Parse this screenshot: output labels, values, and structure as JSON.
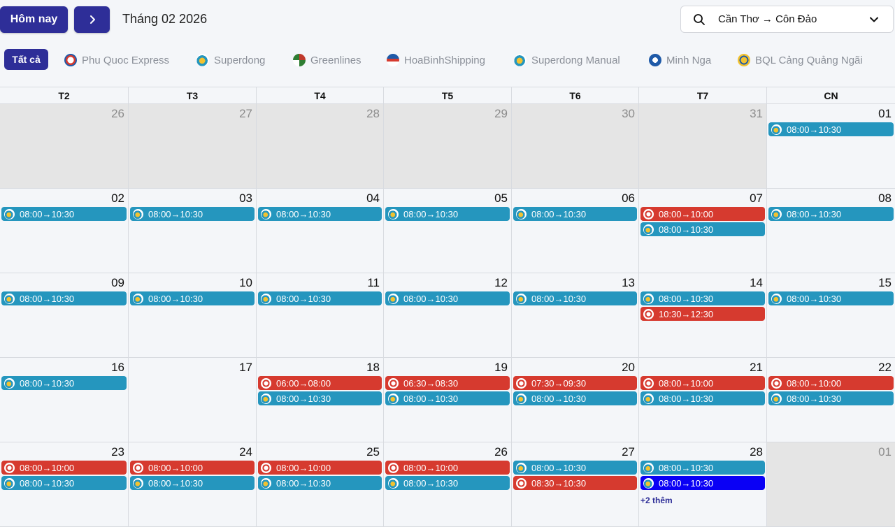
{
  "toolbar": {
    "today_label": "Hôm nay",
    "month_title": "Tháng 02 2026",
    "route": "Cần Thơ → Côn Đảo"
  },
  "filters": {
    "all_label": "Tất cả",
    "operators": [
      {
        "label": "Phu Quoc Express",
        "icon": "phu-quoc-express-logo"
      },
      {
        "label": "Superdong",
        "icon": "superdong-logo"
      },
      {
        "label": "Greenlines",
        "icon": "greenlines-logo"
      },
      {
        "label": "HoaBinhShipping",
        "icon": "hoabinh-logo"
      },
      {
        "label": "Superdong Manual",
        "icon": "superdong-manual-logo"
      },
      {
        "label": "Minh Nga",
        "icon": "minh-nga-logo"
      },
      {
        "label": "BQL Cảng Quảng Ngãi",
        "icon": "bql-cang-logo"
      }
    ]
  },
  "weekdays": [
    "T2",
    "T3",
    "T4",
    "T5",
    "T6",
    "T7",
    "CN"
  ],
  "colors": {
    "superdong": "#2596be",
    "phu_quoc_express": "#d63a2f",
    "selected": "#0a00f5",
    "primary": "#2e2e98"
  },
  "weeks": [
    [
      {
        "day": "26",
        "out": true,
        "events": []
      },
      {
        "day": "27",
        "out": true,
        "events": []
      },
      {
        "day": "28",
        "out": true,
        "events": []
      },
      {
        "day": "29",
        "out": true,
        "events": []
      },
      {
        "day": "30",
        "out": true,
        "events": []
      },
      {
        "day": "31",
        "out": true,
        "events": []
      },
      {
        "day": "01",
        "out": false,
        "events": [
          {
            "time": "08:00→10:30",
            "op": "superdong"
          }
        ]
      }
    ],
    [
      {
        "day": "02",
        "out": false,
        "events": [
          {
            "time": "08:00→10:30",
            "op": "superdong"
          }
        ]
      },
      {
        "day": "03",
        "out": false,
        "events": [
          {
            "time": "08:00→10:30",
            "op": "superdong"
          }
        ]
      },
      {
        "day": "04",
        "out": false,
        "events": [
          {
            "time": "08:00→10:30",
            "op": "superdong"
          }
        ]
      },
      {
        "day": "05",
        "out": false,
        "events": [
          {
            "time": "08:00→10:30",
            "op": "superdong"
          }
        ]
      },
      {
        "day": "06",
        "out": false,
        "events": [
          {
            "time": "08:00→10:30",
            "op": "superdong"
          }
        ]
      },
      {
        "day": "07",
        "out": false,
        "events": [
          {
            "time": "08:00→10:00",
            "op": "phu_quoc_express"
          },
          {
            "time": "08:00→10:30",
            "op": "superdong"
          }
        ]
      },
      {
        "day": "08",
        "out": false,
        "events": [
          {
            "time": "08:00→10:30",
            "op": "superdong"
          }
        ]
      }
    ],
    [
      {
        "day": "09",
        "out": false,
        "events": [
          {
            "time": "08:00→10:30",
            "op": "superdong"
          }
        ]
      },
      {
        "day": "10",
        "out": false,
        "events": [
          {
            "time": "08:00→10:30",
            "op": "superdong"
          }
        ]
      },
      {
        "day": "11",
        "out": false,
        "events": [
          {
            "time": "08:00→10:30",
            "op": "superdong"
          }
        ]
      },
      {
        "day": "12",
        "out": false,
        "events": [
          {
            "time": "08:00→10:30",
            "op": "superdong"
          }
        ]
      },
      {
        "day": "13",
        "out": false,
        "events": [
          {
            "time": "08:00→10:30",
            "op": "superdong"
          }
        ]
      },
      {
        "day": "14",
        "out": false,
        "events": [
          {
            "time": "08:00→10:30",
            "op": "superdong"
          },
          {
            "time": "10:30→12:30",
            "op": "phu_quoc_express"
          }
        ]
      },
      {
        "day": "15",
        "out": false,
        "events": [
          {
            "time": "08:00→10:30",
            "op": "superdong"
          }
        ]
      }
    ],
    [
      {
        "day": "16",
        "out": false,
        "events": [
          {
            "time": "08:00→10:30",
            "op": "superdong"
          }
        ]
      },
      {
        "day": "17",
        "out": false,
        "events": []
      },
      {
        "day": "18",
        "out": false,
        "events": [
          {
            "time": "06:00→08:00",
            "op": "phu_quoc_express"
          },
          {
            "time": "08:00→10:30",
            "op": "superdong"
          }
        ]
      },
      {
        "day": "19",
        "out": false,
        "events": [
          {
            "time": "06:30→08:30",
            "op": "phu_quoc_express"
          },
          {
            "time": "08:00→10:30",
            "op": "superdong"
          }
        ]
      },
      {
        "day": "20",
        "out": false,
        "events": [
          {
            "time": "07:30→09:30",
            "op": "phu_quoc_express"
          },
          {
            "time": "08:00→10:30",
            "op": "superdong"
          }
        ]
      },
      {
        "day": "21",
        "out": false,
        "events": [
          {
            "time": "08:00→10:00",
            "op": "phu_quoc_express"
          },
          {
            "time": "08:00→10:30",
            "op": "superdong"
          }
        ]
      },
      {
        "day": "22",
        "out": false,
        "events": [
          {
            "time": "08:00→10:00",
            "op": "phu_quoc_express"
          },
          {
            "time": "08:00→10:30",
            "op": "superdong"
          }
        ]
      }
    ],
    [
      {
        "day": "23",
        "out": false,
        "events": [
          {
            "time": "08:00→10:00",
            "op": "phu_quoc_express"
          },
          {
            "time": "08:00→10:30",
            "op": "superdong"
          }
        ]
      },
      {
        "day": "24",
        "out": false,
        "events": [
          {
            "time": "08:00→10:00",
            "op": "phu_quoc_express"
          },
          {
            "time": "08:00→10:30",
            "op": "superdong"
          }
        ]
      },
      {
        "day": "25",
        "out": false,
        "events": [
          {
            "time": "08:00→10:00",
            "op": "phu_quoc_express"
          },
          {
            "time": "08:00→10:30",
            "op": "superdong"
          }
        ]
      },
      {
        "day": "26",
        "out": false,
        "events": [
          {
            "time": "08:00→10:00",
            "op": "phu_quoc_express"
          },
          {
            "time": "08:00→10:30",
            "op": "superdong"
          }
        ]
      },
      {
        "day": "27",
        "out": false,
        "events": [
          {
            "time": "08:00→10:30",
            "op": "superdong"
          },
          {
            "time": "08:30→10:30",
            "op": "phu_quoc_express"
          }
        ]
      },
      {
        "day": "28",
        "out": false,
        "events": [
          {
            "time": "08:00→10:30",
            "op": "superdong"
          },
          {
            "time": "08:00→10:30",
            "op": "superdong",
            "selected": true
          }
        ],
        "more": "+2 thêm"
      },
      {
        "day": "01",
        "out": true,
        "events": []
      }
    ]
  ]
}
